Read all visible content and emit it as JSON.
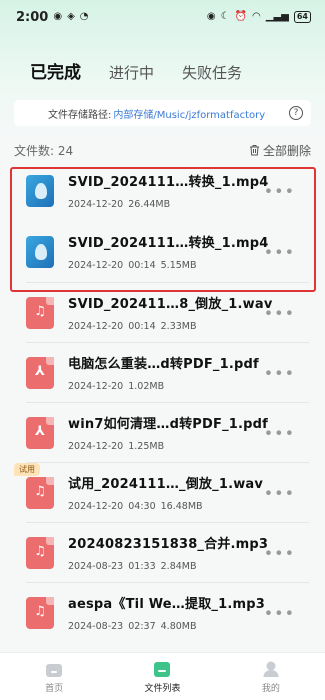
{
  "status_bar": {
    "time": "2:00",
    "battery": "64"
  },
  "tabs": [
    {
      "label": "已完成",
      "active": true
    },
    {
      "label": "进行中",
      "active": false
    },
    {
      "label": "失败任务",
      "active": false
    }
  ],
  "storage": {
    "label": "文件存储路径:",
    "path": "内部存储/Music/jzformatfactory"
  },
  "file_count": "文件数: 24",
  "delete_all": "全部删除",
  "files": [
    {
      "name": "SVID_2024111…转换_1.mp4",
      "meta": "2024-12-20  26.44MB",
      "type": "video"
    },
    {
      "name": "SVID_2024111…转换_1.mp4",
      "meta": "2024-12-20  00:14  5.15MB",
      "type": "video"
    },
    {
      "name": "SVID_202411…8_倒放_1.wav",
      "meta": "2024-12-20  00:14  2.33MB",
      "type": "audio"
    },
    {
      "name": "电脑怎么重装…d转PDF_1.pdf",
      "meta": "2024-12-20  1.02MB",
      "type": "pdf"
    },
    {
      "name": "win7如何清理…d转PDF_1.pdf",
      "meta": "2024-12-20  1.25MB",
      "type": "pdf"
    },
    {
      "name": "试用_2024111…_倒放_1.wav",
      "meta": "2024-12-20  04:30  16.48MB",
      "type": "audio",
      "badge": "试用"
    },
    {
      "name": "20240823151838_合并.mp3",
      "meta": "2024-08-23  01:33  2.84MB",
      "type": "audio"
    },
    {
      "name": "aespa《Til We…提取_1.mp3",
      "meta": "2024-08-23  02:37  4.80MB",
      "type": "audio"
    }
  ],
  "bottom_nav": [
    {
      "label": "首页",
      "icon": "home-icon",
      "active": false
    },
    {
      "label": "文件列表",
      "icon": "file-list-icon",
      "active": true
    },
    {
      "label": "我的",
      "icon": "profile-icon",
      "active": false
    }
  ],
  "colors": {
    "accent": "#3ec48a",
    "highlight": "#e03535",
    "link": "#3a7bd5",
    "file_icon": "#ec6d6d"
  }
}
